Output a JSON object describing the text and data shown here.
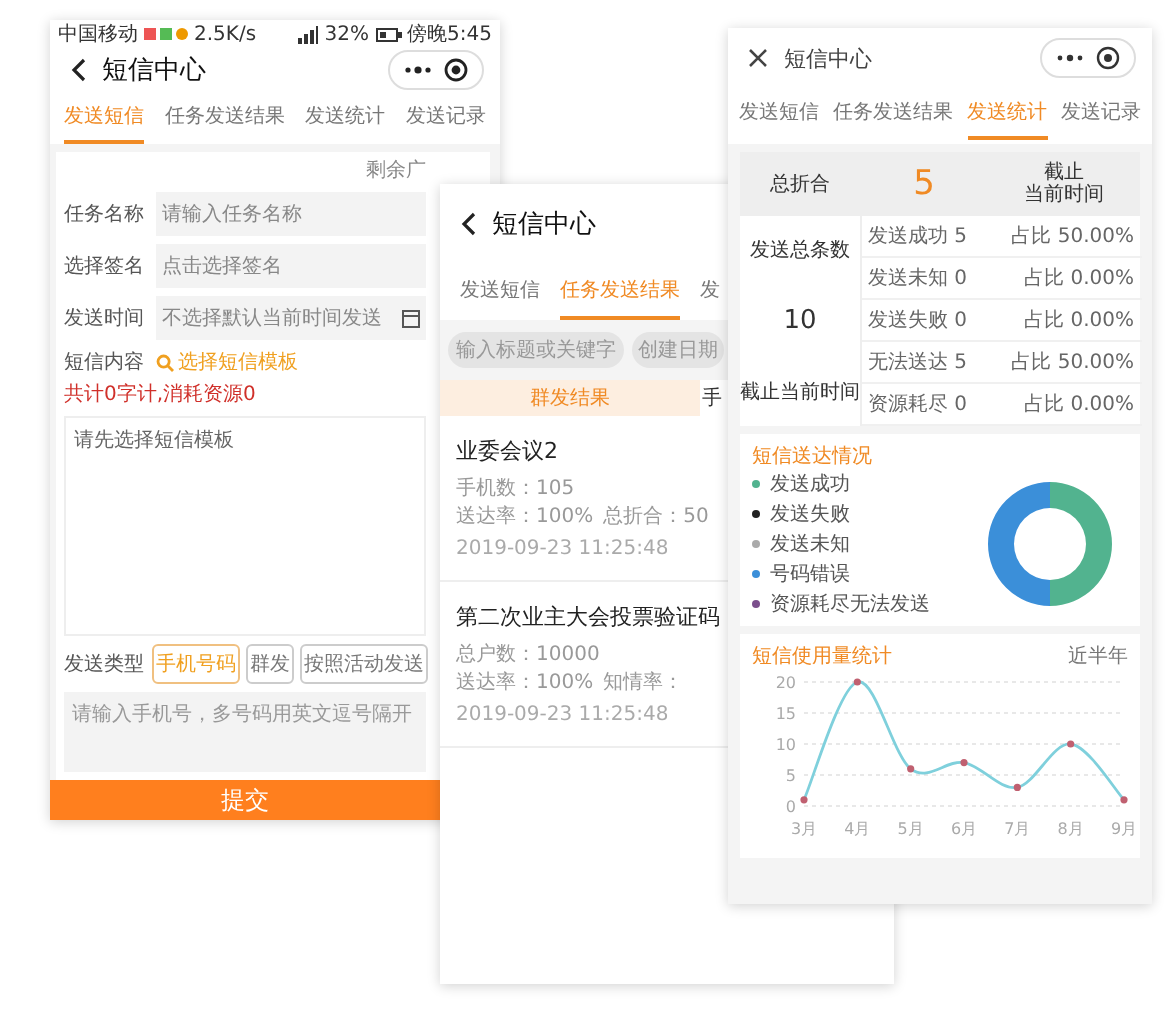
{
  "phone_left": {
    "status_bar": {
      "carrier": "中国移动",
      "speed": "2.5K/s",
      "battery": "32%",
      "time": "傍晚5:45"
    },
    "title": "短信中心",
    "tabs": [
      {
        "label": "发送短信",
        "selected": true
      },
      {
        "label": "任务发送结果",
        "selected": false
      },
      {
        "label": "发送统计",
        "selected": false
      },
      {
        "label": "发送记录",
        "selected": false
      }
    ],
    "remaining": "剩余广",
    "fields": [
      {
        "label": "任务名称",
        "placeholder": "请输入任务名称",
        "kind": "text"
      },
      {
        "label": "选择签名",
        "placeholder": "点击选择签名",
        "kind": "text"
      },
      {
        "label": "发送时间",
        "placeholder": "不选择默认当前时间发送",
        "kind": "date"
      }
    ],
    "content": {
      "label": "短信内容",
      "template_link": "选择短信模板",
      "counter": "共计0字计,消耗资源0",
      "placeholder": "请先选择短信模板"
    },
    "send_type": {
      "label": "发送类型",
      "options": [
        {
          "label": "手机号码",
          "selected": true
        },
        {
          "label": "群发",
          "selected": false
        },
        {
          "label": "按照活动发送",
          "selected": false
        }
      ]
    },
    "phones_placeholder": "请输入手机号，多号码用英文逗号隔开",
    "submit": "提交"
  },
  "phone_middle": {
    "title": "短信中心",
    "tabs": [
      {
        "label": "发送短信",
        "selected": false
      },
      {
        "label": "任务发送结果",
        "selected": true
      },
      {
        "label": "发",
        "selected": false
      }
    ],
    "search_placeholder": "输入标题或关键字",
    "date_filter": "创建日期",
    "subtabs": [
      {
        "label": "群发结果",
        "selected": true
      },
      {
        "label": "手",
        "selected": false
      }
    ],
    "items": [
      {
        "title": "业委会议2",
        "meta": [
          "手机数：105",
          "送达率：100%",
          "总折合：50"
        ],
        "date": "2019-09-23 11:25:48"
      },
      {
        "title": "第二次业主大会投票验证码",
        "meta": [
          "总户数：10000",
          "送达率：100%",
          "知情率："
        ],
        "date": "2019-09-23 11:25:48"
      }
    ]
  },
  "phone_right": {
    "title": "短信中心",
    "tabs": [
      {
        "label": "发送短信",
        "selected": false
      },
      {
        "label": "任务发送结果",
        "selected": false
      },
      {
        "label": "发送统计",
        "selected": true
      },
      {
        "label": "发送记录",
        "selected": false
      }
    ],
    "stats": {
      "total_label": "总折合",
      "total_value": "5",
      "cutoff": [
        "截止",
        "当前时间"
      ],
      "count_label": "发送总条数",
      "count_value": "10",
      "count_cutoff": "截止当前时间",
      "rows": [
        {
          "label": "发送成功 5",
          "share": "占比 50.00%"
        },
        {
          "label": "发送未知 0",
          "share": "占比 0.00%"
        },
        {
          "label": "发送失败 0",
          "share": "占比 0.00%"
        },
        {
          "label": "无法送达 5",
          "share": "占比 50.00%"
        },
        {
          "label": "资源耗尽 0",
          "share": "占比 0.00%"
        }
      ]
    },
    "delivery_card": {
      "title": "短信送达情况",
      "legend": [
        {
          "label": "发送成功",
          "color": "#52b38f"
        },
        {
          "label": "发送失败",
          "color": "#222222"
        },
        {
          "label": "发送未知",
          "color": "#aaaaaa"
        },
        {
          "label": "号码错误",
          "color": "#3b8fd9"
        },
        {
          "label": "资源耗尽无法发送",
          "color": "#7b4f8c"
        }
      ]
    },
    "usage_card": {
      "title": "短信使用量统计",
      "range": "近半年",
      "chart_data": {
        "type": "line",
        "categories": [
          "3月",
          "4月",
          "5月",
          "6月",
          "7月",
          "8月",
          "9月"
        ],
        "ylim": [
          0,
          20
        ],
        "yticks": [
          0,
          5,
          10,
          15,
          20
        ],
        "grid": true,
        "series": [
          {
            "color": "#7fd0dc",
            "marker": true,
            "values": [
              1,
              20,
              6,
              7,
              3,
              10,
              1
            ]
          }
        ]
      }
    }
  }
}
